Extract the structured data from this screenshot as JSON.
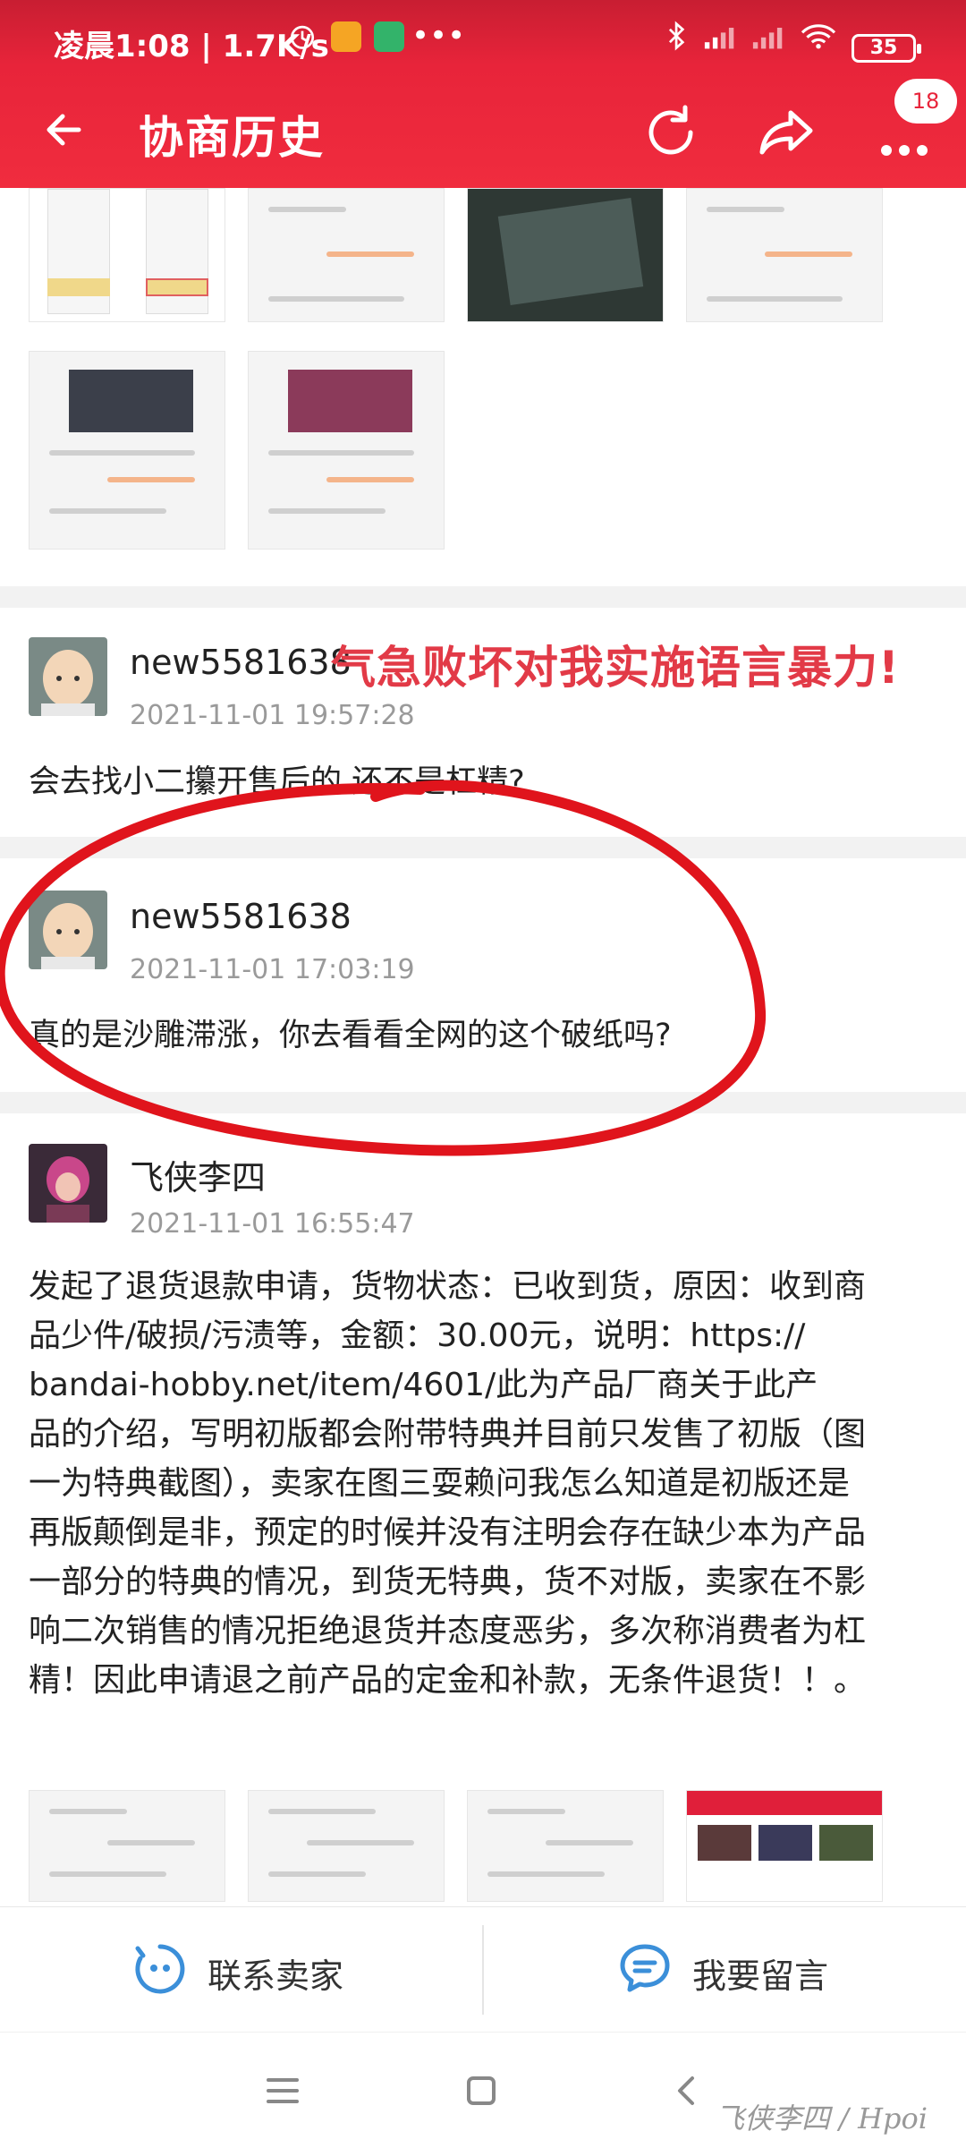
{
  "status_bar": {
    "time_speed": "凌晨1:08 | 1.7K/s",
    "battery": "35"
  },
  "header": {
    "title": "协商历史",
    "badge": "18"
  },
  "icons": {
    "back": "arrow-left-icon",
    "refresh": "refresh-icon",
    "share": "share-icon",
    "more": "more-dots-icon",
    "contact": "chat-face-icon",
    "message": "comment-icon"
  },
  "overlay_annotation": "气急败坏对我实施语言暴力!",
  "comments": [
    {
      "username": "new5581638",
      "timestamp": "2021-11-01 19:57:28",
      "text": "会去找小二攥开售后的  还不是杠精?"
    },
    {
      "username": "new5581638",
      "timestamp": "2021-11-01 17:03:19",
      "text": "真的是沙雕滞涨，你去看看全网的这个破纸吗?"
    },
    {
      "username": "飞侠李四",
      "timestamp": "2021-11-01 16:55:47",
      "text_lines": [
        "发起了退货退款申请，货物状态：已收到货，原因：收到商",
        "品少件/破损/污渍等，金额：30.00元，说明：https://",
        "bandai-hobby.net/item/4601/此为产品厂商关于此产",
        "品的介绍，写明初版都会附带特典并目前只发售了初版（图",
        "一为特典截图），卖家在图三耍赖问我怎么知道是初版还是",
        "再版颠倒是非，预定的时候并没有注明会存在缺少本为产品",
        "一部分的特典的情况，到货无特典，货不对版，卖家在不影",
        "响二次销售的情况拒绝退货并态度恶劣，多次称消费者为杠",
        "精！因此申请退之前产品的定金和补款，无条件退货！！。"
      ]
    }
  ],
  "actions": {
    "contact_seller": "联系卖家",
    "leave_message": "我要留言"
  },
  "watermark": "飞侠李四 / Hpoi",
  "colors": {
    "header_red": "#e8243a",
    "annotation_red": "#e23a47",
    "circle_red": "#e0141c",
    "icon_blue": "#3b8fd9"
  }
}
